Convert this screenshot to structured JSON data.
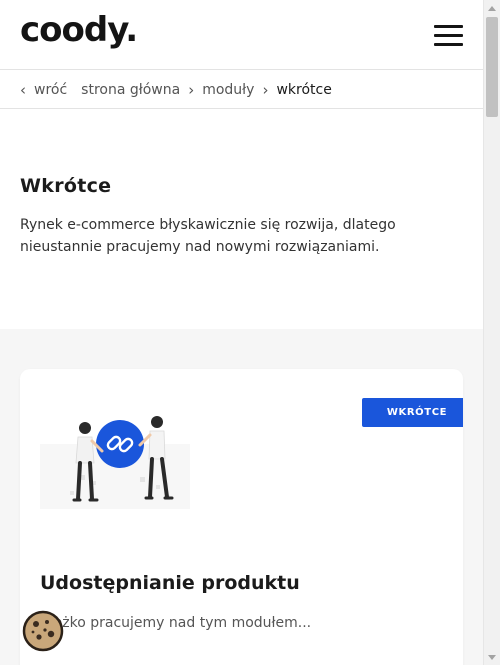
{
  "header": {
    "logo": "coody.",
    "menu_icon": "hamburger-icon"
  },
  "breadcrumb": {
    "back_label": "wróć",
    "items": [
      "strona główna",
      "moduły"
    ],
    "current": "wkrótce"
  },
  "intro": {
    "title": "Wkrótce",
    "description": "Rynek e-commerce błyskawicznie się rozwija, dlatego nieustannie pracujemy nad nowymi rozwiązaniami."
  },
  "module_card": {
    "badge": "wkrótce",
    "title": "Udostępnianie produktu",
    "description": "Ciężko pracujemy nad tym modułem..."
  },
  "colors": {
    "accent": "#1a56db",
    "section_bg": "#f6f6f6"
  },
  "icons": [
    "chevron-left-icon",
    "chevron-right-icon",
    "link-icon",
    "cookie-icon"
  ]
}
